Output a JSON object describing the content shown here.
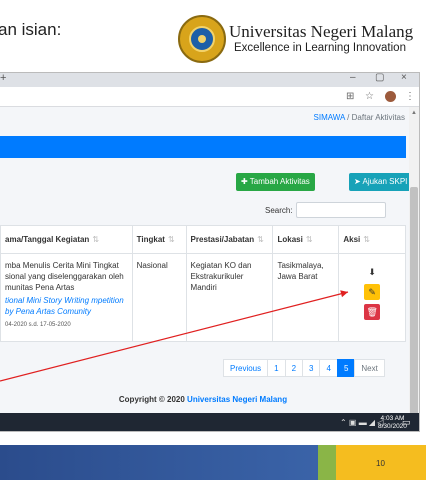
{
  "slide": {
    "header_text": "an isian:",
    "university_name": "Universitas Negeri Malang",
    "tagline": "Excellence in Learning Innovation",
    "slide_number": "10"
  },
  "browser": {
    "new_tab": "+",
    "minimize": "–",
    "maximize": "▢",
    "close": "×"
  },
  "breadcrumb": {
    "root": "SIMAWA",
    "separator": "/",
    "current": "Daftar Aktivitas"
  },
  "toolbar": {
    "add_label": "Tambah Aktivitas",
    "submit_label": "Ajukan SKPI",
    "search_label": "Search:",
    "search_value": ""
  },
  "table": {
    "headers": [
      "ama/Tanggal Kegiatan",
      "Tingkat",
      "Prestasi/Jabatan",
      "Lokasi",
      "Aksi"
    ],
    "rows": [
      {
        "kegiatan": "mba Menulis Cerita Mini Tingkat sional yang diselenggarakan oleh munitas Pena Artas",
        "kegiatan_en": "tional Mini Story Writing mpetition by Pena Artas Comunity",
        "tanggal": "04-2020 s.d. 17-05-2020",
        "tingkat": "Nasional",
        "prestasi": "Kegiatan KO dan Ekstrakurikuler Mandiri",
        "lokasi": "Tasikmalaya, Jawa Barat"
      }
    ]
  },
  "pagination": {
    "previous": "Previous",
    "pages": [
      "1",
      "2",
      "3",
      "4",
      "5"
    ],
    "active_page": "5",
    "next": "Next"
  },
  "footer": {
    "prefix": "Copyright © 2020",
    "link": "Universitas Negeri Malang"
  },
  "taskbar": {
    "time": "4:03 AM",
    "date": "8/30/2020"
  },
  "colors": {
    "primary": "#007bff",
    "success": "#28a745",
    "info": "#17a2b8",
    "warning": "#ffc107",
    "danger": "#dc3545",
    "arrow": "#e02020"
  }
}
